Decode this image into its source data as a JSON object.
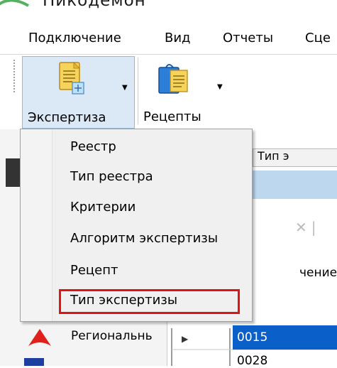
{
  "window": {
    "title": "Никодемон"
  },
  "menu": {
    "items": [
      {
        "label": "Подключение"
      },
      {
        "label": "Вид"
      },
      {
        "label": "Отчеты"
      },
      {
        "label": "Сце"
      }
    ]
  },
  "toolbar": {
    "expert_label": "Экспертиза",
    "recipes_label": "Рецепты"
  },
  "dropdown": {
    "items": [
      {
        "label": "Реестр"
      },
      {
        "label": "Тип реестра"
      },
      {
        "label": "Критерии"
      },
      {
        "label": "Алгоритм экспертизы"
      },
      {
        "label": "Рецепт"
      },
      {
        "label": "Тип экспертизы"
      }
    ],
    "highlighted": "Тип экспертизы",
    "highlight_color": "#e3140f"
  },
  "background": {
    "column_header": "Тип э",
    "column_name": "чение",
    "region_label": "Региональнь",
    "rows": [
      {
        "code": "0015",
        "selected": true
      },
      {
        "code": "0028",
        "selected": false
      }
    ],
    "accent_color": "#0a60c8"
  }
}
